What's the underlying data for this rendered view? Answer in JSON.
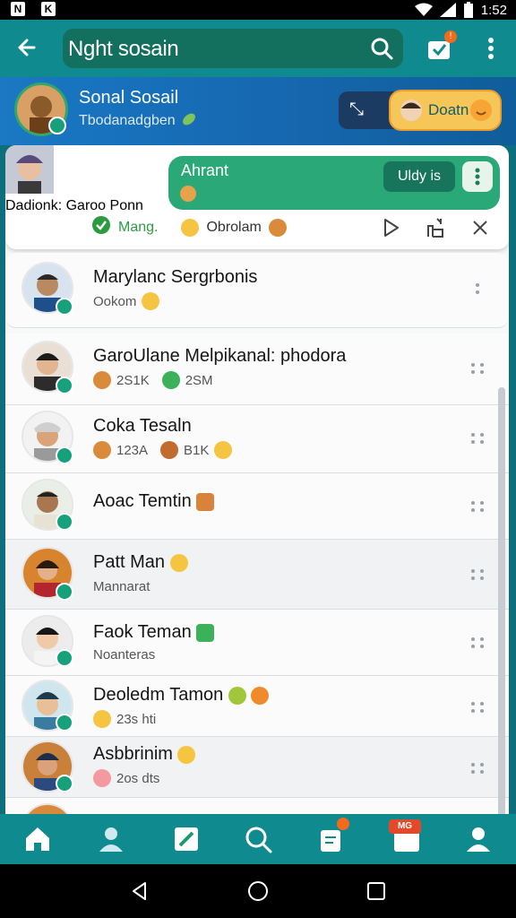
{
  "status_bar": {
    "left_icons": [
      "N",
      "K"
    ],
    "time": "1:52"
  },
  "app_bar": {
    "title": "Nght sosain",
    "inbox_badge": "!"
  },
  "profile": {
    "name": "Sonal Sosail",
    "subtitle": "Tbodanadgben",
    "pill_label": "Doatn"
  },
  "active_chat": {
    "name": "Dadionk:",
    "subtitle": "Garoo Ponn",
    "bubble_label": "Ahrant",
    "chip_label": "Uldy is",
    "status_ok": "Mang.",
    "status_other": "Obrolam"
  },
  "contacts": [
    {
      "name": "Marylanc Sergrbonis",
      "sub": "Ookom"
    },
    {
      "name": "GaroUlane Melpikanal: phodora",
      "sub_a": "2S1K",
      "sub_b": "2SM"
    },
    {
      "name": "Coka Tesaln",
      "sub_a": "123A",
      "sub_b": "B1K"
    },
    {
      "name": "Aoac Temtin",
      "sub": ""
    },
    {
      "name": "Patt Man",
      "sub": "Mannarat"
    },
    {
      "name": "Faok Teman",
      "sub": "Noanteras"
    },
    {
      "name": "Deoledm Tamon",
      "sub": "23s hti"
    },
    {
      "name": "Asbbrinim",
      "sub": "2os dts"
    }
  ],
  "bottom_nav": {
    "items": [
      "home-icon",
      "contacts-icon",
      "edit-icon",
      "search-icon",
      "notes-icon",
      "store-icon",
      "profile-icon"
    ],
    "tag_label": "MG"
  },
  "colors": {
    "app_bar": "#0f8a8f",
    "bubble": "#2aa877",
    "verified": "#16a07c",
    "badge": "#f26a1b"
  }
}
